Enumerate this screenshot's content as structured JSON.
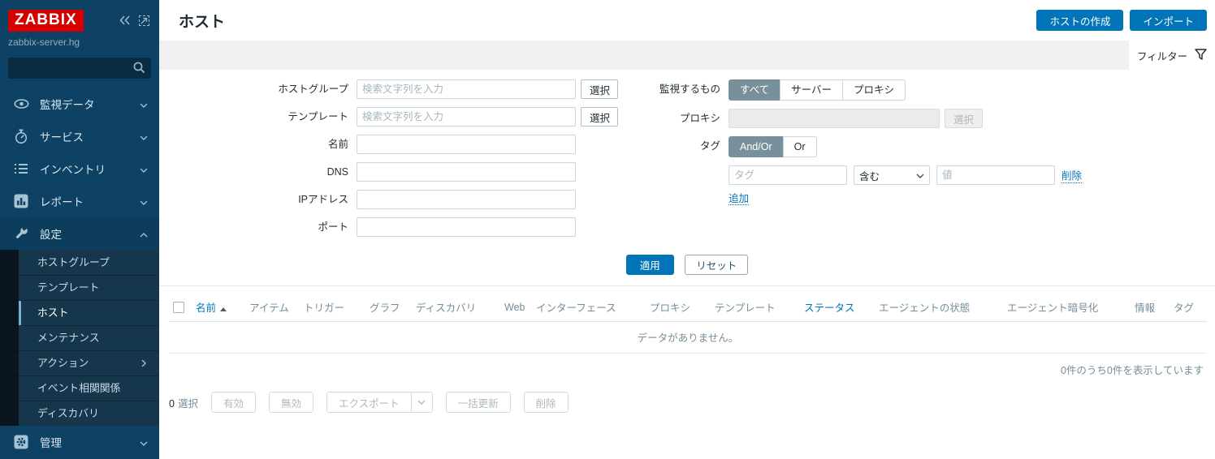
{
  "sidebar": {
    "logo_text": "ZABBIX",
    "server_name": "zabbix-server.hg",
    "menu": [
      {
        "label": "監視データ",
        "icon": "eye-icon"
      },
      {
        "label": "サービス",
        "icon": "stopwatch-icon"
      },
      {
        "label": "インベントリ",
        "icon": "list-icon"
      },
      {
        "label": "レポート",
        "icon": "bar-chart-icon"
      },
      {
        "label": "設定",
        "icon": "wrench-icon"
      },
      {
        "label": "管理",
        "icon": "gear-icon"
      }
    ],
    "submenu": [
      {
        "label": "ホストグループ"
      },
      {
        "label": "テンプレート"
      },
      {
        "label": "ホスト"
      },
      {
        "label": "メンテナンス"
      },
      {
        "label": "アクション"
      },
      {
        "label": "イベント相関関係"
      },
      {
        "label": "ディスカバリ"
      }
    ],
    "selected_submenu": "ホスト"
  },
  "header": {
    "title": "ホスト",
    "create_host_button": "ホストの作成",
    "import_button": "インポート"
  },
  "filter": {
    "tab_label": "フィルター",
    "host_group_label": "ホストグループ",
    "host_group_placeholder": "検索文字列を入力",
    "template_label": "テンプレート",
    "template_placeholder": "検索文字列を入力",
    "name_label": "名前",
    "dns_label": "DNS",
    "ip_label": "IPアドレス",
    "port_label": "ポート",
    "select_button": "選択",
    "monitored_by_label": "監視するもの",
    "monitored_by_options": [
      {
        "label": "すべて",
        "selected": true
      },
      {
        "label": "サーバー",
        "selected": false
      },
      {
        "label": "プロキシ",
        "selected": false
      }
    ],
    "proxy_label": "プロキシ",
    "tags_label": "タグ",
    "tag_logic_options": [
      {
        "label": "And/Or",
        "selected": true
      },
      {
        "label": "Or",
        "selected": false
      }
    ],
    "tag_placeholder": "タグ",
    "tag_operator_value": "含む",
    "value_placeholder": "値",
    "remove_link": "削除",
    "add_link": "追加",
    "apply_button": "適用",
    "reset_button": "リセット"
  },
  "table": {
    "columns": [
      {
        "label": "名前"
      },
      {
        "label": "アイテム"
      },
      {
        "label": "トリガー"
      },
      {
        "label": "グラフ"
      },
      {
        "label": "ディスカバリ"
      },
      {
        "label": "Web"
      },
      {
        "label": "インターフェース"
      },
      {
        "label": "プロキシ"
      },
      {
        "label": "テンプレート"
      },
      {
        "label": "ステータス"
      },
      {
        "label": "エージェントの状態"
      },
      {
        "label": "エージェント暗号化"
      },
      {
        "label": "情報"
      },
      {
        "label": "タグ"
      }
    ],
    "empty_text": "データがありません。",
    "stats_text": "0件のうち0件を表示しています"
  },
  "action_bar": {
    "selected_count": "0",
    "selected_label": "選択",
    "enable_button": "有効",
    "disable_button": "無効",
    "export_button": "エクスポート",
    "mass_update_button": "一括更新",
    "delete_button": "削除"
  },
  "colors": {
    "accent": "#0275b8",
    "logo_red": "#d40000",
    "sidebar_bg": "#0e4265",
    "selected_marker": "#72b0dd"
  }
}
